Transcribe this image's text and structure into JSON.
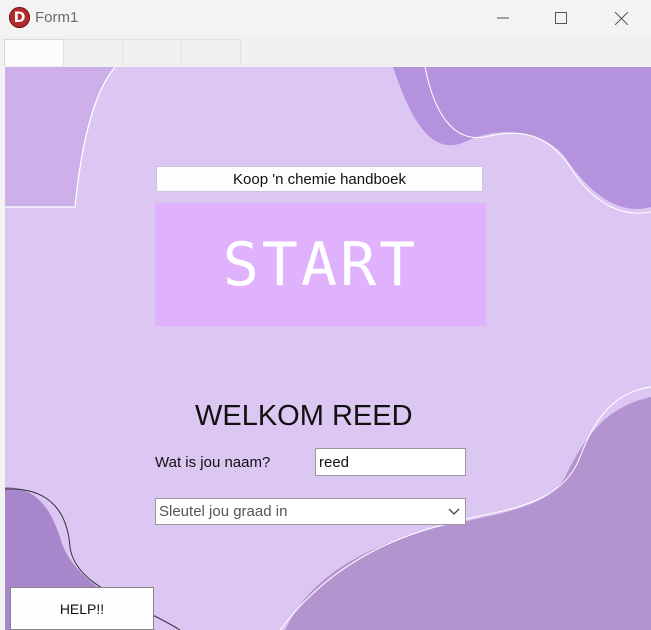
{
  "window": {
    "title": "Form1",
    "app_icon_letter": "D",
    "app_icon_color": "#b52a2a"
  },
  "tabs": [
    "",
    "",
    "",
    ""
  ],
  "main": {
    "buy_button_label": "Koop 'n chemie handboek",
    "start_button_label": "START",
    "welcome_text": "WELKOM REED",
    "name_label": "Wat is jou naam?",
    "name_value": "reed",
    "grade_select_value": "Sleutel jou graad in",
    "help_button_label": "HELP!!"
  },
  "colors": {
    "background": "#dcc7f2",
    "start_button": "#e0b1fd",
    "blob_dark": "#b08fd8"
  }
}
